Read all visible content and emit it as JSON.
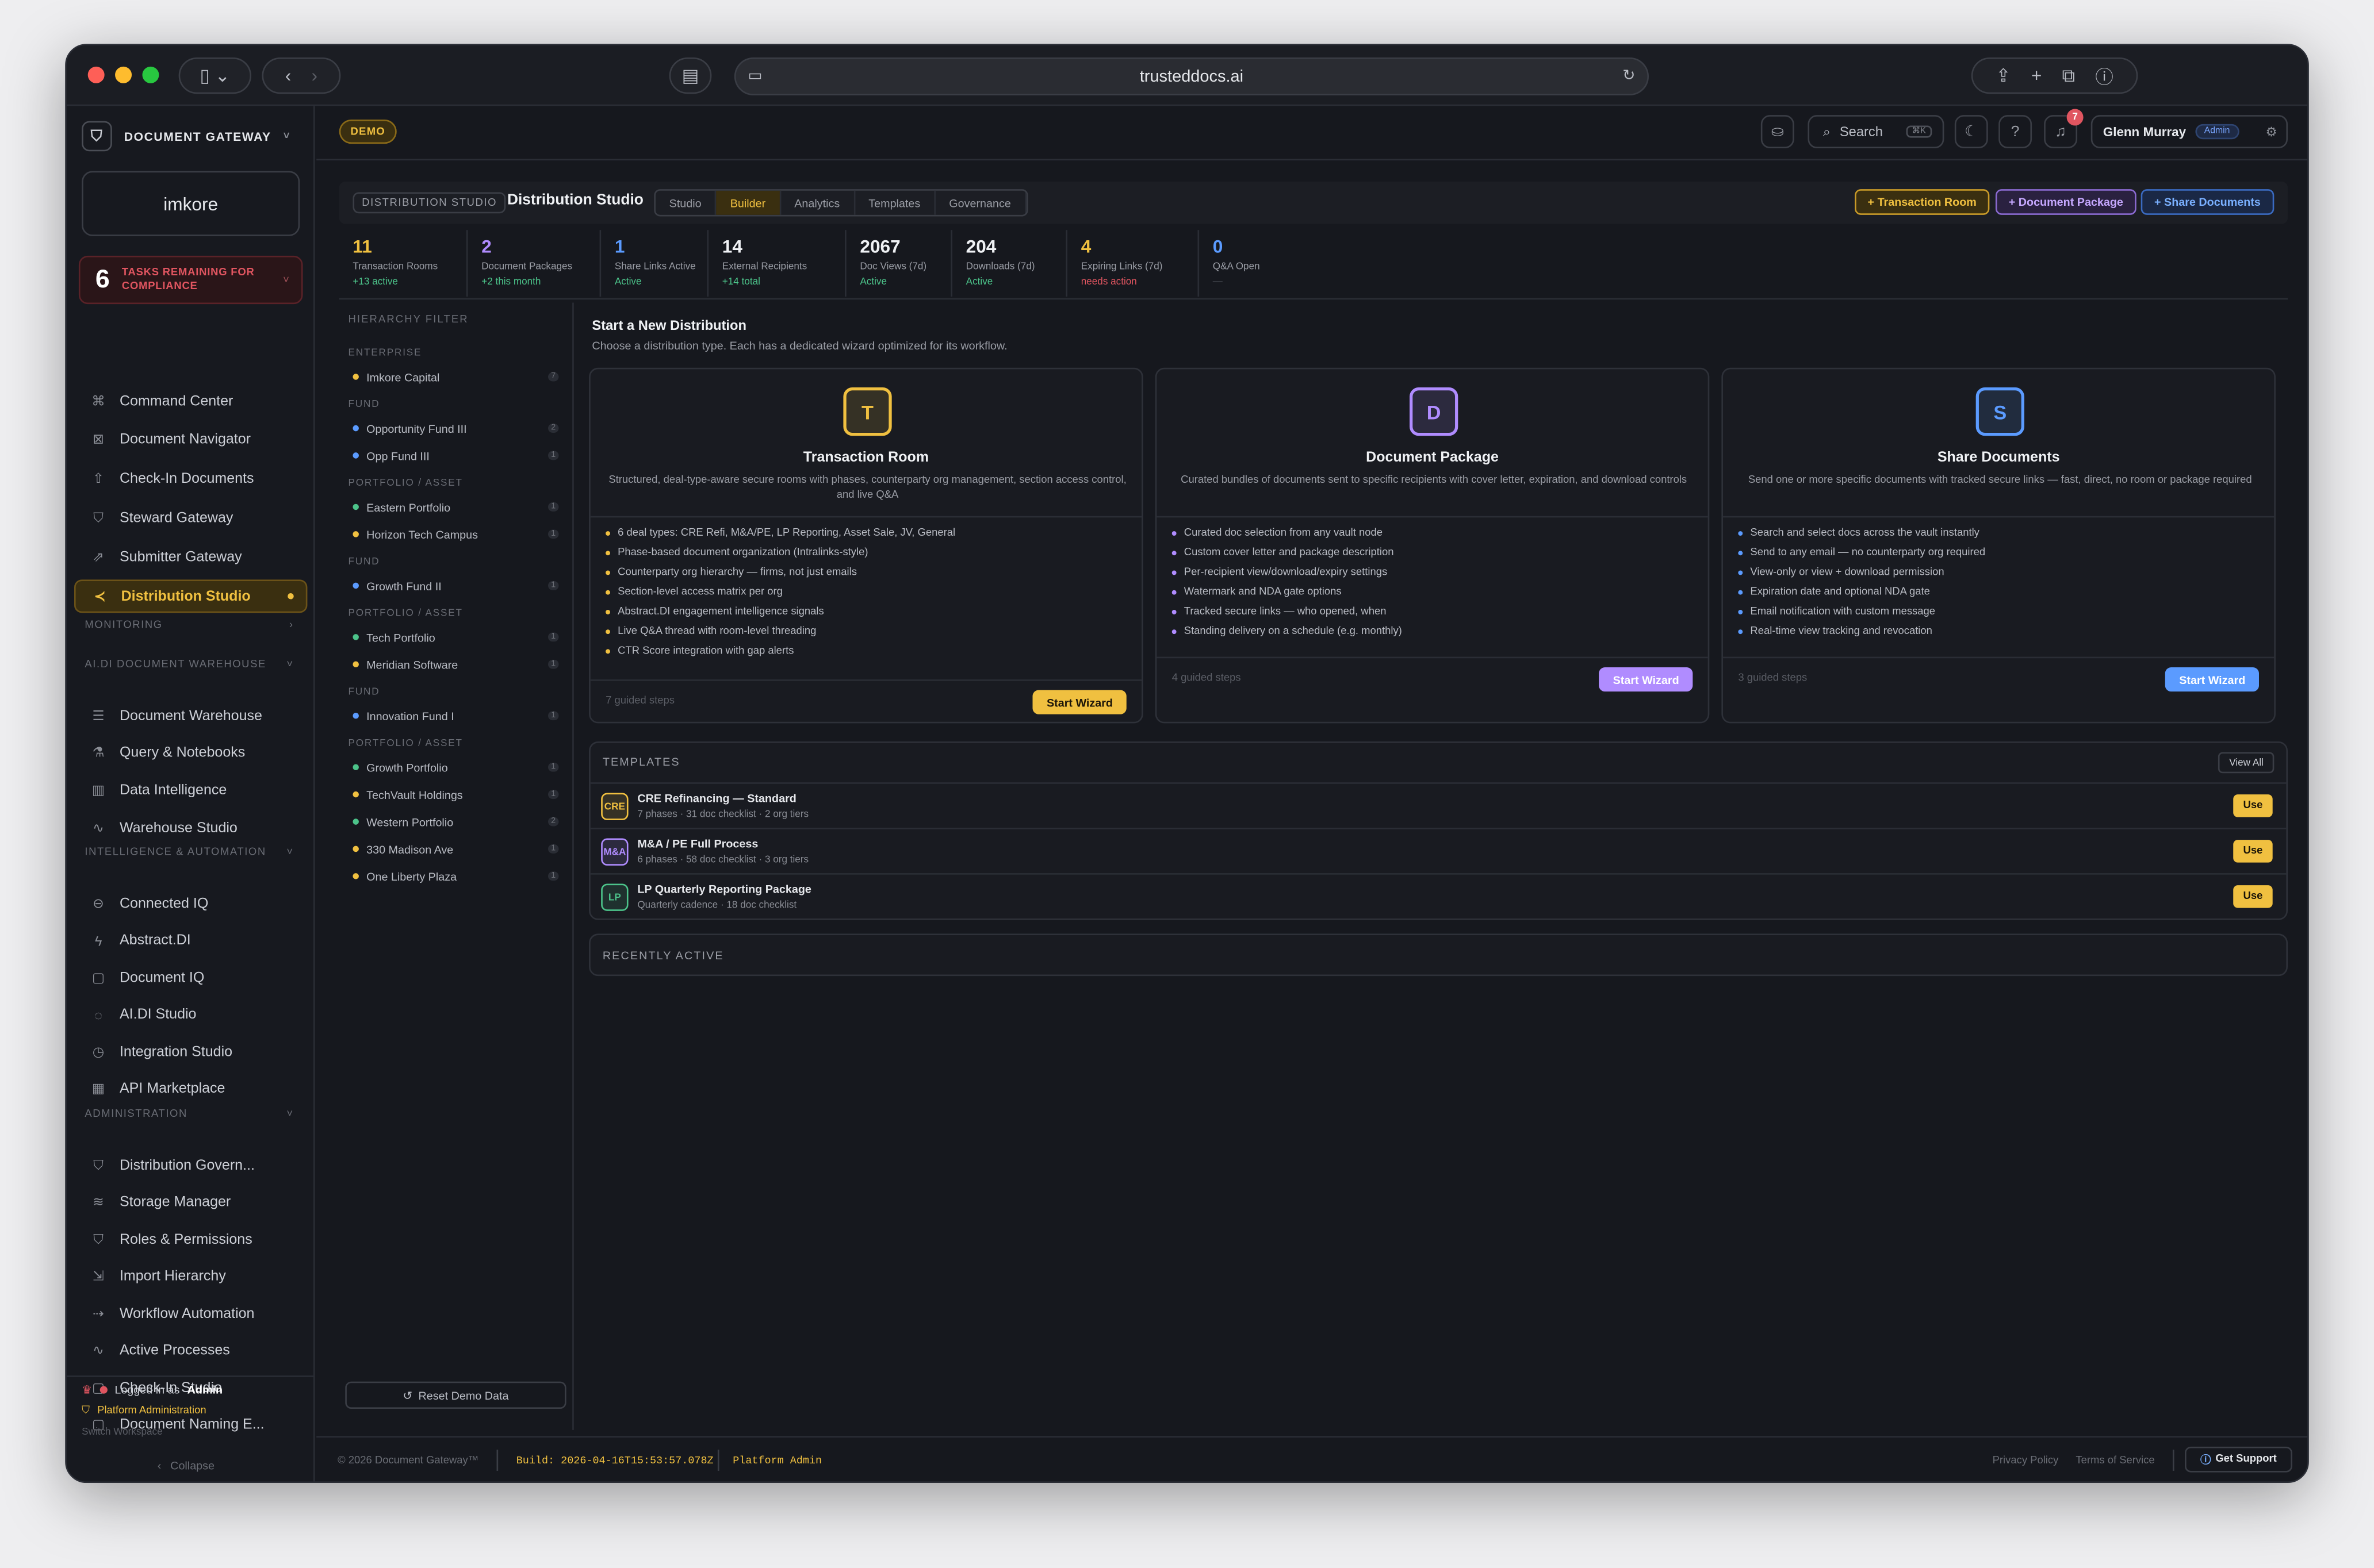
{
  "browser": {
    "url": "trusteddocs.ai"
  },
  "colors": {
    "accent": "#f0c040",
    "purple": "#b08cff",
    "blue": "#5b9bff",
    "green": "#4cc38a",
    "red": "#e05560"
  },
  "sidebar": {
    "brand": "DOCUMENT GATEWAY",
    "logo": "imkore",
    "tasks_count": "6",
    "tasks_label": "TASKS REMAINING FOR COMPLIANCE",
    "items_top": [
      {
        "label": "Command Center",
        "icon": "command-icon"
      },
      {
        "label": "Document Navigator",
        "icon": "navigator-icon"
      },
      {
        "label": "Check-In Documents",
        "icon": "upload-icon"
      },
      {
        "label": "Steward Gateway",
        "icon": "steward-icon"
      },
      {
        "label": "Submitter Gateway",
        "icon": "external-icon"
      },
      {
        "label": "Distribution Studio",
        "icon": "share-icon"
      }
    ],
    "sec_monitoring": "MONITORING",
    "sec_warehouse": "AI.DI DOCUMENT WAREHOUSE",
    "items_warehouse": [
      {
        "label": "Document Warehouse",
        "icon": "database-icon"
      },
      {
        "label": "Query & Notebooks",
        "icon": "flask-icon"
      },
      {
        "label": "Data Intelligence",
        "icon": "bar-chart-icon"
      },
      {
        "label": "Warehouse Studio",
        "icon": "activity-icon"
      }
    ],
    "sec_intel": "INTELLIGENCE & AUTOMATION",
    "items_intel": [
      {
        "label": "Connected IQ",
        "icon": "link-icon"
      },
      {
        "label": "Abstract.DI",
        "icon": "lightning-icon"
      },
      {
        "label": "Document IQ",
        "icon": "document-icon"
      },
      {
        "label": "AI.DI Studio",
        "icon": "lightbulb-icon"
      },
      {
        "label": "Integration Studio",
        "icon": "plug-icon"
      },
      {
        "label": "API Marketplace",
        "icon": "store-icon"
      }
    ],
    "sec_admin": "ADMINISTRATION",
    "items_admin": [
      {
        "label": "Distribution Govern...",
        "icon": "shield-icon"
      },
      {
        "label": "Storage Manager",
        "icon": "layers-icon"
      },
      {
        "label": "Roles & Permissions",
        "icon": "shield-icon"
      },
      {
        "label": "Import Hierarchy",
        "icon": "import-icon"
      },
      {
        "label": "Workflow Automation",
        "icon": "workflow-icon"
      },
      {
        "label": "Active Processes",
        "icon": "pulse-icon"
      },
      {
        "label": "Check-In Studio",
        "icon": "document-icon"
      },
      {
        "label": "Document Naming E...",
        "icon": "document-icon"
      }
    ],
    "logged_in": "Logged in as",
    "logged_user": "Admin",
    "platform_admin": "Platform Administration",
    "switch": "Switch Workspace",
    "collapse": "Collapse"
  },
  "topbar": {
    "demo": "DEMO",
    "search": "Search",
    "search_kbd": "⌘K",
    "notif_count": "7",
    "user": "Glenn Murray",
    "role": "Admin"
  },
  "studio": {
    "crumb": "DISTRIBUTION STUDIO",
    "title": "Distribution Studio",
    "tabs": [
      "Studio",
      "Builder",
      "Analytics",
      "Templates",
      "Governance"
    ],
    "btn_room": "+ Transaction Room",
    "btn_package": "+ Document Package",
    "btn_share": "+ Share Documents"
  },
  "stats": [
    {
      "value": "11",
      "label": "Transaction Rooms",
      "sub": "+13 active",
      "color": "#f0c040",
      "subcolor": "#4cc38a"
    },
    {
      "value": "2",
      "label": "Document Packages",
      "sub": "+2 this month",
      "color": "#b08cff",
      "subcolor": "#4cc38a"
    },
    {
      "value": "1",
      "label": "Share Links Active",
      "sub": "Active",
      "color": "#5b9bff",
      "subcolor": "#4cc38a"
    },
    {
      "value": "14",
      "label": "External Recipients",
      "sub": "+14 total",
      "color": "#f0f2f5",
      "subcolor": "#4cc38a"
    },
    {
      "value": "2067",
      "label": "Doc Views (7d)",
      "sub": "Active",
      "color": "#f0f2f5",
      "subcolor": "#4cc38a"
    },
    {
      "value": "204",
      "label": "Downloads (7d)",
      "sub": "Active",
      "color": "#f0f2f5",
      "subcolor": "#4cc38a"
    },
    {
      "value": "4",
      "label": "Expiring Links (7d)",
      "sub": "needs action",
      "color": "#f0c040",
      "subcolor": "#e05560"
    },
    {
      "value": "0",
      "label": "Q&A Open",
      "sub": "—",
      "color": "#5b9bff",
      "subcolor": "#6a6d75"
    }
  ],
  "hierarchy": {
    "title": "HIERARCHY FILTER",
    "groups": [
      {
        "label": "ENTERPRISE",
        "items": [
          {
            "name": "Imkore Capital",
            "count": "7",
            "color": "#f0c040"
          }
        ]
      },
      {
        "label": "FUND",
        "items": [
          {
            "name": "Opportunity Fund III",
            "count": "2",
            "color": "#5b9bff"
          },
          {
            "name": "Opp Fund III",
            "count": "1",
            "color": "#5b9bff"
          }
        ]
      },
      {
        "label": "PORTFOLIO / ASSET",
        "items": [
          {
            "name": "Eastern Portfolio",
            "count": "1",
            "color": "#4cc38a"
          },
          {
            "name": "Horizon Tech Campus",
            "count": "1",
            "color": "#f0c040"
          }
        ]
      },
      {
        "label": "FUND",
        "items": [
          {
            "name": "Growth Fund II",
            "count": "1",
            "color": "#5b9bff"
          }
        ]
      },
      {
        "label": "PORTFOLIO / ASSET",
        "items": [
          {
            "name": "Tech Portfolio",
            "count": "1",
            "color": "#4cc38a"
          },
          {
            "name": "Meridian Software",
            "count": "1",
            "color": "#f0c040"
          }
        ]
      },
      {
        "label": "FUND",
        "items": [
          {
            "name": "Innovation Fund I",
            "count": "1",
            "color": "#5b9bff"
          }
        ]
      },
      {
        "label": "PORTFOLIO / ASSET",
        "items": [
          {
            "name": "Growth Portfolio",
            "count": "1",
            "color": "#4cc38a"
          },
          {
            "name": "TechVault Holdings",
            "count": "1",
            "color": "#f0c040"
          },
          {
            "name": "Western Portfolio",
            "count": "2",
            "color": "#4cc38a"
          },
          {
            "name": "330 Madison Ave",
            "count": "1",
            "color": "#f0c040"
          },
          {
            "name": "One Liberty Plaza",
            "count": "1",
            "color": "#f0c040"
          }
        ]
      }
    ],
    "reset": "Reset Demo Data"
  },
  "distribution": {
    "title": "Start a New Distribution",
    "subtitle": "Choose a distribution type. Each has a dedicated wizard optimized for its workflow.",
    "cards": [
      {
        "letter": "T",
        "title": "Transaction Room",
        "desc": "Structured, deal-type-aware secure rooms with phases, counterparty org management, section access control, and live Q&A",
        "color": "#f0c040",
        "features": [
          "6 deal types: CRE Refi, M&A/PE, LP Reporting, Asset Sale, JV, General",
          "Phase-based document organization (Intralinks-style)",
          "Counterparty org hierarchy — firms, not just emails",
          "Section-level access matrix per org",
          "Abstract.DI engagement intelligence signals",
          "Live Q&A thread with room-level threading",
          "CTR Score integration with gap alerts"
        ],
        "steps": "7 guided steps",
        "button": "Start Wizard"
      },
      {
        "letter": "D",
        "title": "Document Package",
        "desc": "Curated bundles of documents sent to specific recipients with cover letter, expiration, and download controls",
        "color": "#b08cff",
        "features": [
          "Curated doc selection from any vault node",
          "Custom cover letter and package description",
          "Per-recipient view/download/expiry settings",
          "Watermark and NDA gate options",
          "Tracked secure links — who opened, when",
          "Standing delivery on a schedule (e.g. monthly)"
        ],
        "steps": "4 guided steps",
        "button": "Start Wizard"
      },
      {
        "letter": "S",
        "title": "Share Documents",
        "desc": "Send one or more specific documents with tracked secure links — fast, direct, no room or package required",
        "color": "#5b9bff",
        "features": [
          "Search and select docs across the vault instantly",
          "Send to any email — no counterparty org required",
          "View-only or view + download permission",
          "Expiration date and optional NDA gate",
          "Email notification with custom message",
          "Real-time view tracking and revocation"
        ],
        "steps": "3 guided steps",
        "button": "Start Wizard"
      }
    ]
  },
  "templates": {
    "title": "TEMPLATES",
    "view_all": "View All",
    "rows": [
      {
        "icon": "CRE",
        "name": "CRE Refinancing — Standard",
        "meta": "7 phases · 31 doc checklist · 2 org tiers",
        "color": "#f0c040",
        "use": "Use"
      },
      {
        "icon": "M&A",
        "name": "M&A / PE Full Process",
        "meta": "6 phases · 58 doc checklist · 3 org tiers",
        "color": "#b08cff",
        "use": "Use"
      },
      {
        "icon": "LP",
        "name": "LP Quarterly Reporting Package",
        "meta": "Quarterly cadence · 18 doc checklist",
        "color": "#4cc38a",
        "use": "Use"
      }
    ]
  },
  "recent": {
    "title": "RECENTLY ACTIVE"
  },
  "footer": {
    "copyright": "© 2026 Document Gateway™",
    "build": "Build: 2026-04-16T15:53:57.078Z",
    "platform": "Platform Admin",
    "privacy": "Privacy Policy",
    "terms": "Terms of Service",
    "support": "Get Support"
  }
}
